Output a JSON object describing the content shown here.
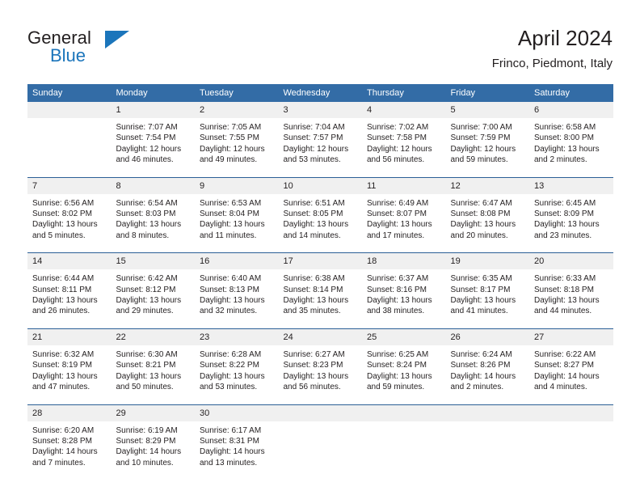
{
  "brand": {
    "name_part1": "General",
    "name_part2": "Blue",
    "logo_icon": "triangle-flag-icon"
  },
  "header": {
    "title": "April 2024",
    "subtitle": "Frinco, Piedmont, Italy"
  },
  "calendar": {
    "weekday_headers": [
      "Sunday",
      "Monday",
      "Tuesday",
      "Wednesday",
      "Thursday",
      "Friday",
      "Saturday"
    ],
    "accent_color": "#336ca6",
    "daynum_band_color": "#f0f0f0",
    "weeks": [
      [
        {
          "day": "",
          "sunrise": "",
          "sunset": "",
          "daylight1": "",
          "daylight2": ""
        },
        {
          "day": "1",
          "sunrise": "Sunrise: 7:07 AM",
          "sunset": "Sunset: 7:54 PM",
          "daylight1": "Daylight: 12 hours",
          "daylight2": "and 46 minutes."
        },
        {
          "day": "2",
          "sunrise": "Sunrise: 7:05 AM",
          "sunset": "Sunset: 7:55 PM",
          "daylight1": "Daylight: 12 hours",
          "daylight2": "and 49 minutes."
        },
        {
          "day": "3",
          "sunrise": "Sunrise: 7:04 AM",
          "sunset": "Sunset: 7:57 PM",
          "daylight1": "Daylight: 12 hours",
          "daylight2": "and 53 minutes."
        },
        {
          "day": "4",
          "sunrise": "Sunrise: 7:02 AM",
          "sunset": "Sunset: 7:58 PM",
          "daylight1": "Daylight: 12 hours",
          "daylight2": "and 56 minutes."
        },
        {
          "day": "5",
          "sunrise": "Sunrise: 7:00 AM",
          "sunset": "Sunset: 7:59 PM",
          "daylight1": "Daylight: 12 hours",
          "daylight2": "and 59 minutes."
        },
        {
          "day": "6",
          "sunrise": "Sunrise: 6:58 AM",
          "sunset": "Sunset: 8:00 PM",
          "daylight1": "Daylight: 13 hours",
          "daylight2": "and 2 minutes."
        }
      ],
      [
        {
          "day": "7",
          "sunrise": "Sunrise: 6:56 AM",
          "sunset": "Sunset: 8:02 PM",
          "daylight1": "Daylight: 13 hours",
          "daylight2": "and 5 minutes."
        },
        {
          "day": "8",
          "sunrise": "Sunrise: 6:54 AM",
          "sunset": "Sunset: 8:03 PM",
          "daylight1": "Daylight: 13 hours",
          "daylight2": "and 8 minutes."
        },
        {
          "day": "9",
          "sunrise": "Sunrise: 6:53 AM",
          "sunset": "Sunset: 8:04 PM",
          "daylight1": "Daylight: 13 hours",
          "daylight2": "and 11 minutes."
        },
        {
          "day": "10",
          "sunrise": "Sunrise: 6:51 AM",
          "sunset": "Sunset: 8:05 PM",
          "daylight1": "Daylight: 13 hours",
          "daylight2": "and 14 minutes."
        },
        {
          "day": "11",
          "sunrise": "Sunrise: 6:49 AM",
          "sunset": "Sunset: 8:07 PM",
          "daylight1": "Daylight: 13 hours",
          "daylight2": "and 17 minutes."
        },
        {
          "day": "12",
          "sunrise": "Sunrise: 6:47 AM",
          "sunset": "Sunset: 8:08 PM",
          "daylight1": "Daylight: 13 hours",
          "daylight2": "and 20 minutes."
        },
        {
          "day": "13",
          "sunrise": "Sunrise: 6:45 AM",
          "sunset": "Sunset: 8:09 PM",
          "daylight1": "Daylight: 13 hours",
          "daylight2": "and 23 minutes."
        }
      ],
      [
        {
          "day": "14",
          "sunrise": "Sunrise: 6:44 AM",
          "sunset": "Sunset: 8:11 PM",
          "daylight1": "Daylight: 13 hours",
          "daylight2": "and 26 minutes."
        },
        {
          "day": "15",
          "sunrise": "Sunrise: 6:42 AM",
          "sunset": "Sunset: 8:12 PM",
          "daylight1": "Daylight: 13 hours",
          "daylight2": "and 29 minutes."
        },
        {
          "day": "16",
          "sunrise": "Sunrise: 6:40 AM",
          "sunset": "Sunset: 8:13 PM",
          "daylight1": "Daylight: 13 hours",
          "daylight2": "and 32 minutes."
        },
        {
          "day": "17",
          "sunrise": "Sunrise: 6:38 AM",
          "sunset": "Sunset: 8:14 PM",
          "daylight1": "Daylight: 13 hours",
          "daylight2": "and 35 minutes."
        },
        {
          "day": "18",
          "sunrise": "Sunrise: 6:37 AM",
          "sunset": "Sunset: 8:16 PM",
          "daylight1": "Daylight: 13 hours",
          "daylight2": "and 38 minutes."
        },
        {
          "day": "19",
          "sunrise": "Sunrise: 6:35 AM",
          "sunset": "Sunset: 8:17 PM",
          "daylight1": "Daylight: 13 hours",
          "daylight2": "and 41 minutes."
        },
        {
          "day": "20",
          "sunrise": "Sunrise: 6:33 AM",
          "sunset": "Sunset: 8:18 PM",
          "daylight1": "Daylight: 13 hours",
          "daylight2": "and 44 minutes."
        }
      ],
      [
        {
          "day": "21",
          "sunrise": "Sunrise: 6:32 AM",
          "sunset": "Sunset: 8:19 PM",
          "daylight1": "Daylight: 13 hours",
          "daylight2": "and 47 minutes."
        },
        {
          "day": "22",
          "sunrise": "Sunrise: 6:30 AM",
          "sunset": "Sunset: 8:21 PM",
          "daylight1": "Daylight: 13 hours",
          "daylight2": "and 50 minutes."
        },
        {
          "day": "23",
          "sunrise": "Sunrise: 6:28 AM",
          "sunset": "Sunset: 8:22 PM",
          "daylight1": "Daylight: 13 hours",
          "daylight2": "and 53 minutes."
        },
        {
          "day": "24",
          "sunrise": "Sunrise: 6:27 AM",
          "sunset": "Sunset: 8:23 PM",
          "daylight1": "Daylight: 13 hours",
          "daylight2": "and 56 minutes."
        },
        {
          "day": "25",
          "sunrise": "Sunrise: 6:25 AM",
          "sunset": "Sunset: 8:24 PM",
          "daylight1": "Daylight: 13 hours",
          "daylight2": "and 59 minutes."
        },
        {
          "day": "26",
          "sunrise": "Sunrise: 6:24 AM",
          "sunset": "Sunset: 8:26 PM",
          "daylight1": "Daylight: 14 hours",
          "daylight2": "and 2 minutes."
        },
        {
          "day": "27",
          "sunrise": "Sunrise: 6:22 AM",
          "sunset": "Sunset: 8:27 PM",
          "daylight1": "Daylight: 14 hours",
          "daylight2": "and 4 minutes."
        }
      ],
      [
        {
          "day": "28",
          "sunrise": "Sunrise: 6:20 AM",
          "sunset": "Sunset: 8:28 PM",
          "daylight1": "Daylight: 14 hours",
          "daylight2": "and 7 minutes."
        },
        {
          "day": "29",
          "sunrise": "Sunrise: 6:19 AM",
          "sunset": "Sunset: 8:29 PM",
          "daylight1": "Daylight: 14 hours",
          "daylight2": "and 10 minutes."
        },
        {
          "day": "30",
          "sunrise": "Sunrise: 6:17 AM",
          "sunset": "Sunset: 8:31 PM",
          "daylight1": "Daylight: 14 hours",
          "daylight2": "and 13 minutes."
        },
        {
          "day": "",
          "sunrise": "",
          "sunset": "",
          "daylight1": "",
          "daylight2": ""
        },
        {
          "day": "",
          "sunrise": "",
          "sunset": "",
          "daylight1": "",
          "daylight2": ""
        },
        {
          "day": "",
          "sunrise": "",
          "sunset": "",
          "daylight1": "",
          "daylight2": ""
        },
        {
          "day": "",
          "sunrise": "",
          "sunset": "",
          "daylight1": "",
          "daylight2": ""
        }
      ]
    ]
  }
}
